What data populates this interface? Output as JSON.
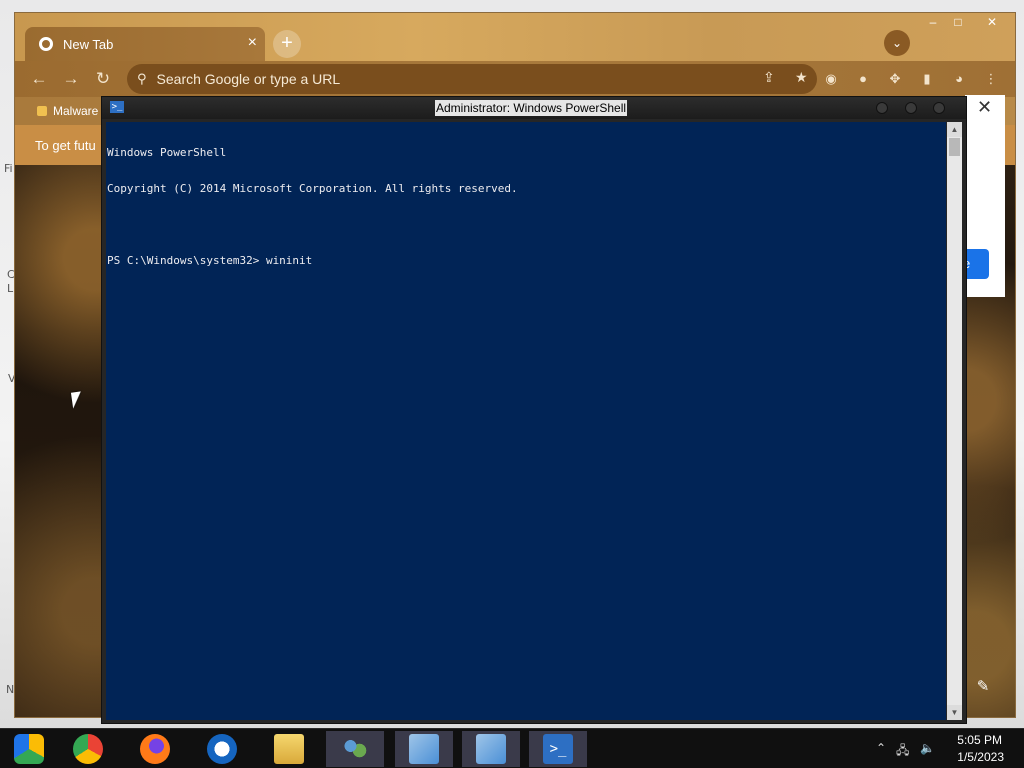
{
  "chrome": {
    "tab_title": "New Tab",
    "tab_close": "×",
    "new_tab": "+",
    "omnibox_placeholder": "Search Google or type a URL",
    "bookmark": "Malware",
    "infobar_text": "To get futu",
    "dialog_close": "✕",
    "dialog_button": "e",
    "window_controls": {
      "minimize": "–",
      "maximize": "□",
      "close": "✕"
    },
    "accent": "#c8984f"
  },
  "powershell": {
    "title": "Administrator: Windows PowerShell",
    "lines": [
      "Windows PowerShell",
      "Copyright (C) 2014 Microsoft Corporation. All rights reserved.",
      "",
      "PS C:\\Windows\\system32> wininit"
    ],
    "background": "#012456",
    "foreground": "#eeedf0"
  },
  "taskbar": {
    "items": [
      {
        "name": "chrome-canary-icon",
        "color": "#1f74e8"
      },
      {
        "name": "chrome-icon",
        "color": "#e53935"
      },
      {
        "name": "firefox-icon",
        "color": "#ff7a18"
      },
      {
        "name": "opera-icon",
        "color": "#1565c0"
      },
      {
        "name": "file-explorer-icon",
        "color": "#e8c25a"
      },
      {
        "name": "network-people-icon",
        "color": "#6aa84f"
      },
      {
        "name": "installer-icon",
        "color": "#4a8fd6"
      },
      {
        "name": "installer-icon-2",
        "color": "#4a8fd6"
      },
      {
        "name": "powershell-icon",
        "color": "#2d6fc3"
      }
    ],
    "time": "5:05 PM",
    "date": "1/5/2023"
  }
}
